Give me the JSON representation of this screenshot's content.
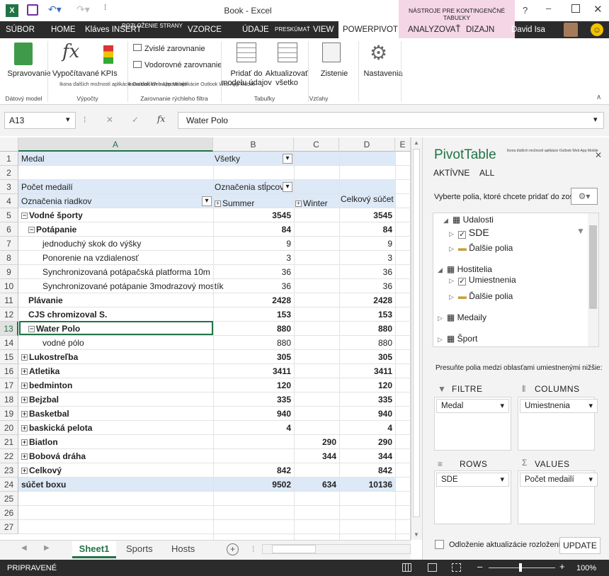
{
  "window": {
    "title": "Book - Excel",
    "context_group": "NÁSTROJE PRE KONTINGENČNÉ TABUĽKY",
    "help": "?",
    "user": "David Isa"
  },
  "tabs": [
    "SÚBOR",
    "HOME",
    "Kláves INSERT",
    "ROZLOŽENIE STRANY",
    "VZORCE",
    "ÚDAJE",
    "PRESKÚMAŤ",
    "VIEW",
    "POWERPIVOT",
    "ANALYZOVAŤ",
    "DIZAJN"
  ],
  "ribbon": {
    "manage": "Spravovanie",
    "calc": "Vypočítavané",
    "kpis": "KPIs",
    "calc_hint": "Ikona ďalších možností aplikácie Outlook Web App Mobile",
    "vert_align": "Zvislé zarovnanie",
    "horiz_align": "Vodorovné zarovnanie",
    "add_model": "Pridať do modelu údajov",
    "update_all": "Aktualizovať všetko",
    "detect": "Zistenie",
    "settings": "Nastavenia",
    "grp_data_model": "Dátový model",
    "grp_calc": "Výpočty",
    "grp_slicer": "Zarovnanie rýchleho filtra",
    "grp_tables": "Tabuľky",
    "grp_relations": "Vzťahy"
  },
  "formula": {
    "namebox": "A13",
    "fx": "fx",
    "value": "Water Polo",
    "cancel": "✕",
    "confirm": "✓"
  },
  "columns": [
    "A",
    "B",
    "C",
    "D",
    "E"
  ],
  "rows": [
    {
      "n": "1",
      "a": "Medal",
      "b": "Všetky",
      "c": "",
      "d": "",
      "hdr": true
    },
    {
      "n": "2",
      "a": "",
      "b": "",
      "c": "",
      "d": ""
    },
    {
      "n": "3",
      "a": "Počet medailí",
      "b": "Označenia stĺpcov",
      "c": "",
      "d": "",
      "hdr": true
    },
    {
      "n": "4",
      "a": "Označenia riadkov",
      "b": "Summer",
      "c": "Winter",
      "d": "Celkový súčet",
      "hdr": true
    },
    {
      "n": "5",
      "a": "Vodné športy",
      "b": "3545",
      "c": "",
      "d": "3545",
      "bold": true,
      "ind": 0,
      "exp": "minus"
    },
    {
      "n": "6",
      "a": "Potápanie",
      "b": "84",
      "c": "",
      "d": "84",
      "bold": true,
      "ind": 1,
      "exp": "minus"
    },
    {
      "n": "7",
      "a": "jednoduchý skok do výšky",
      "b": "9",
      "c": "",
      "d": "9",
      "ind": 3
    },
    {
      "n": "8",
      "a": "Ponorenie na vzdialenosť",
      "b": "3",
      "c": "",
      "d": "3",
      "ind": 3
    },
    {
      "n": "9",
      "a": "Synchronizovaná potápačská platforma 10m",
      "b": "36",
      "c": "",
      "d": "36",
      "ind": 3
    },
    {
      "n": "10",
      "a": "Synchronizované potápanie 3modrazový mostík",
      "b": "36",
      "c": "",
      "d": "36",
      "ind": 3
    },
    {
      "n": "11",
      "a": "Plávanie",
      "b": "2428",
      "c": "",
      "d": "2428",
      "bold": true,
      "ind": 1
    },
    {
      "n": "12",
      "a": "CJS chromizoval S.",
      "b": "153",
      "c": "",
      "d": "153",
      "bold": true,
      "ind": 1
    },
    {
      "n": "13",
      "a": "Water Polo",
      "b": "880",
      "c": "",
      "d": "880",
      "bold": true,
      "ind": 1,
      "exp": "minus"
    },
    {
      "n": "14",
      "a": "vodné pólo",
      "b": "880",
      "c": "",
      "d": "880",
      "ind": 3
    },
    {
      "n": "15",
      "a": "Lukostreľba",
      "b": "305",
      "c": "",
      "d": "305",
      "bold": true,
      "ind": 0,
      "exp": "plus"
    },
    {
      "n": "16",
      "a": "Atletika",
      "b": "3411",
      "c": "",
      "d": "3411",
      "bold": true,
      "ind": 0,
      "exp": "plus"
    },
    {
      "n": "17",
      "a": "bedminton",
      "b": "120",
      "c": "",
      "d": "120",
      "bold": true,
      "ind": 0,
      "exp": "plus"
    },
    {
      "n": "18",
      "a": "Bejzbal",
      "b": "335",
      "c": "",
      "d": "335",
      "bold": true,
      "ind": 0,
      "exp": "plus"
    },
    {
      "n": "19",
      "a": "Basketbal",
      "b": "940",
      "c": "",
      "d": "940",
      "bold": true,
      "ind": 0,
      "exp": "plus"
    },
    {
      "n": "20",
      "a": "baskická pelota",
      "b": "4",
      "c": "",
      "d": "4",
      "bold": true,
      "ind": 0,
      "exp": "plus"
    },
    {
      "n": "21",
      "a": "Biatlon",
      "b": "",
      "c": "290",
      "d": "290",
      "bold": true,
      "ind": 0,
      "exp": "plus"
    },
    {
      "n": "22",
      "a": "Bobová dráha",
      "b": "",
      "c": "344",
      "d": "344",
      "bold": true,
      "ind": 0,
      "exp": "plus"
    },
    {
      "n": "23",
      "a": "Celkový",
      "b": "842",
      "c": "",
      "d": "842",
      "bold": true,
      "ind": 0,
      "exp": "plus"
    },
    {
      "n": "24",
      "a": "súčet boxu",
      "b": "9502",
      "c": "634",
      "d": "10136",
      "bold": true,
      "ind": 0,
      "total": true
    },
    {
      "n": "25",
      "a": "",
      "b": "",
      "c": "",
      "d": ""
    },
    {
      "n": "26",
      "a": "",
      "b": "",
      "c": "",
      "d": ""
    },
    {
      "n": "27",
      "a": "",
      "b": "",
      "c": "",
      "d": ""
    }
  ],
  "sheets": [
    "Sheet1",
    "Sports",
    "Hosts"
  ],
  "status": {
    "ready": "PRIPRAVENÉ",
    "zoom": "100%"
  },
  "pane": {
    "title": "PivotTable",
    "tiny": "Ikona ďalších možností aplikácie Outlook Web App Mobile",
    "tab_active": "AKTÍVNE",
    "tab_all": "ALL",
    "choose": "Vyberte polia, ktoré chcete pridať do zostavy:",
    "tree": {
      "events": "Udalosti",
      "sde": "SDE",
      "more1": "Ďalšie polia",
      "hosts": "Hostitelia",
      "placement": "Umiestnenia",
      "more2": "Ďalšie polia",
      "medals": "Medaily",
      "sport": "Šport"
    },
    "drag": "Presuňte polia medzi oblasťami umiestnenými nižšie:",
    "filters": "FILTRE",
    "columns": "COLUMNS",
    "rows": "ROWS",
    "values": "VALUES",
    "filter_val": "Medal",
    "col_val": "Umiestnenia",
    "row_val": "SDE",
    "val_val": "Počet medailí",
    "defer": "Odloženie aktualizácie rozloženia",
    "update": "UPDATE"
  },
  "colors": {
    "accent": "#217346",
    "tabbar": "#2b2b2b",
    "context": "#f4d6e6",
    "pivot_header": "#dde9f6"
  }
}
